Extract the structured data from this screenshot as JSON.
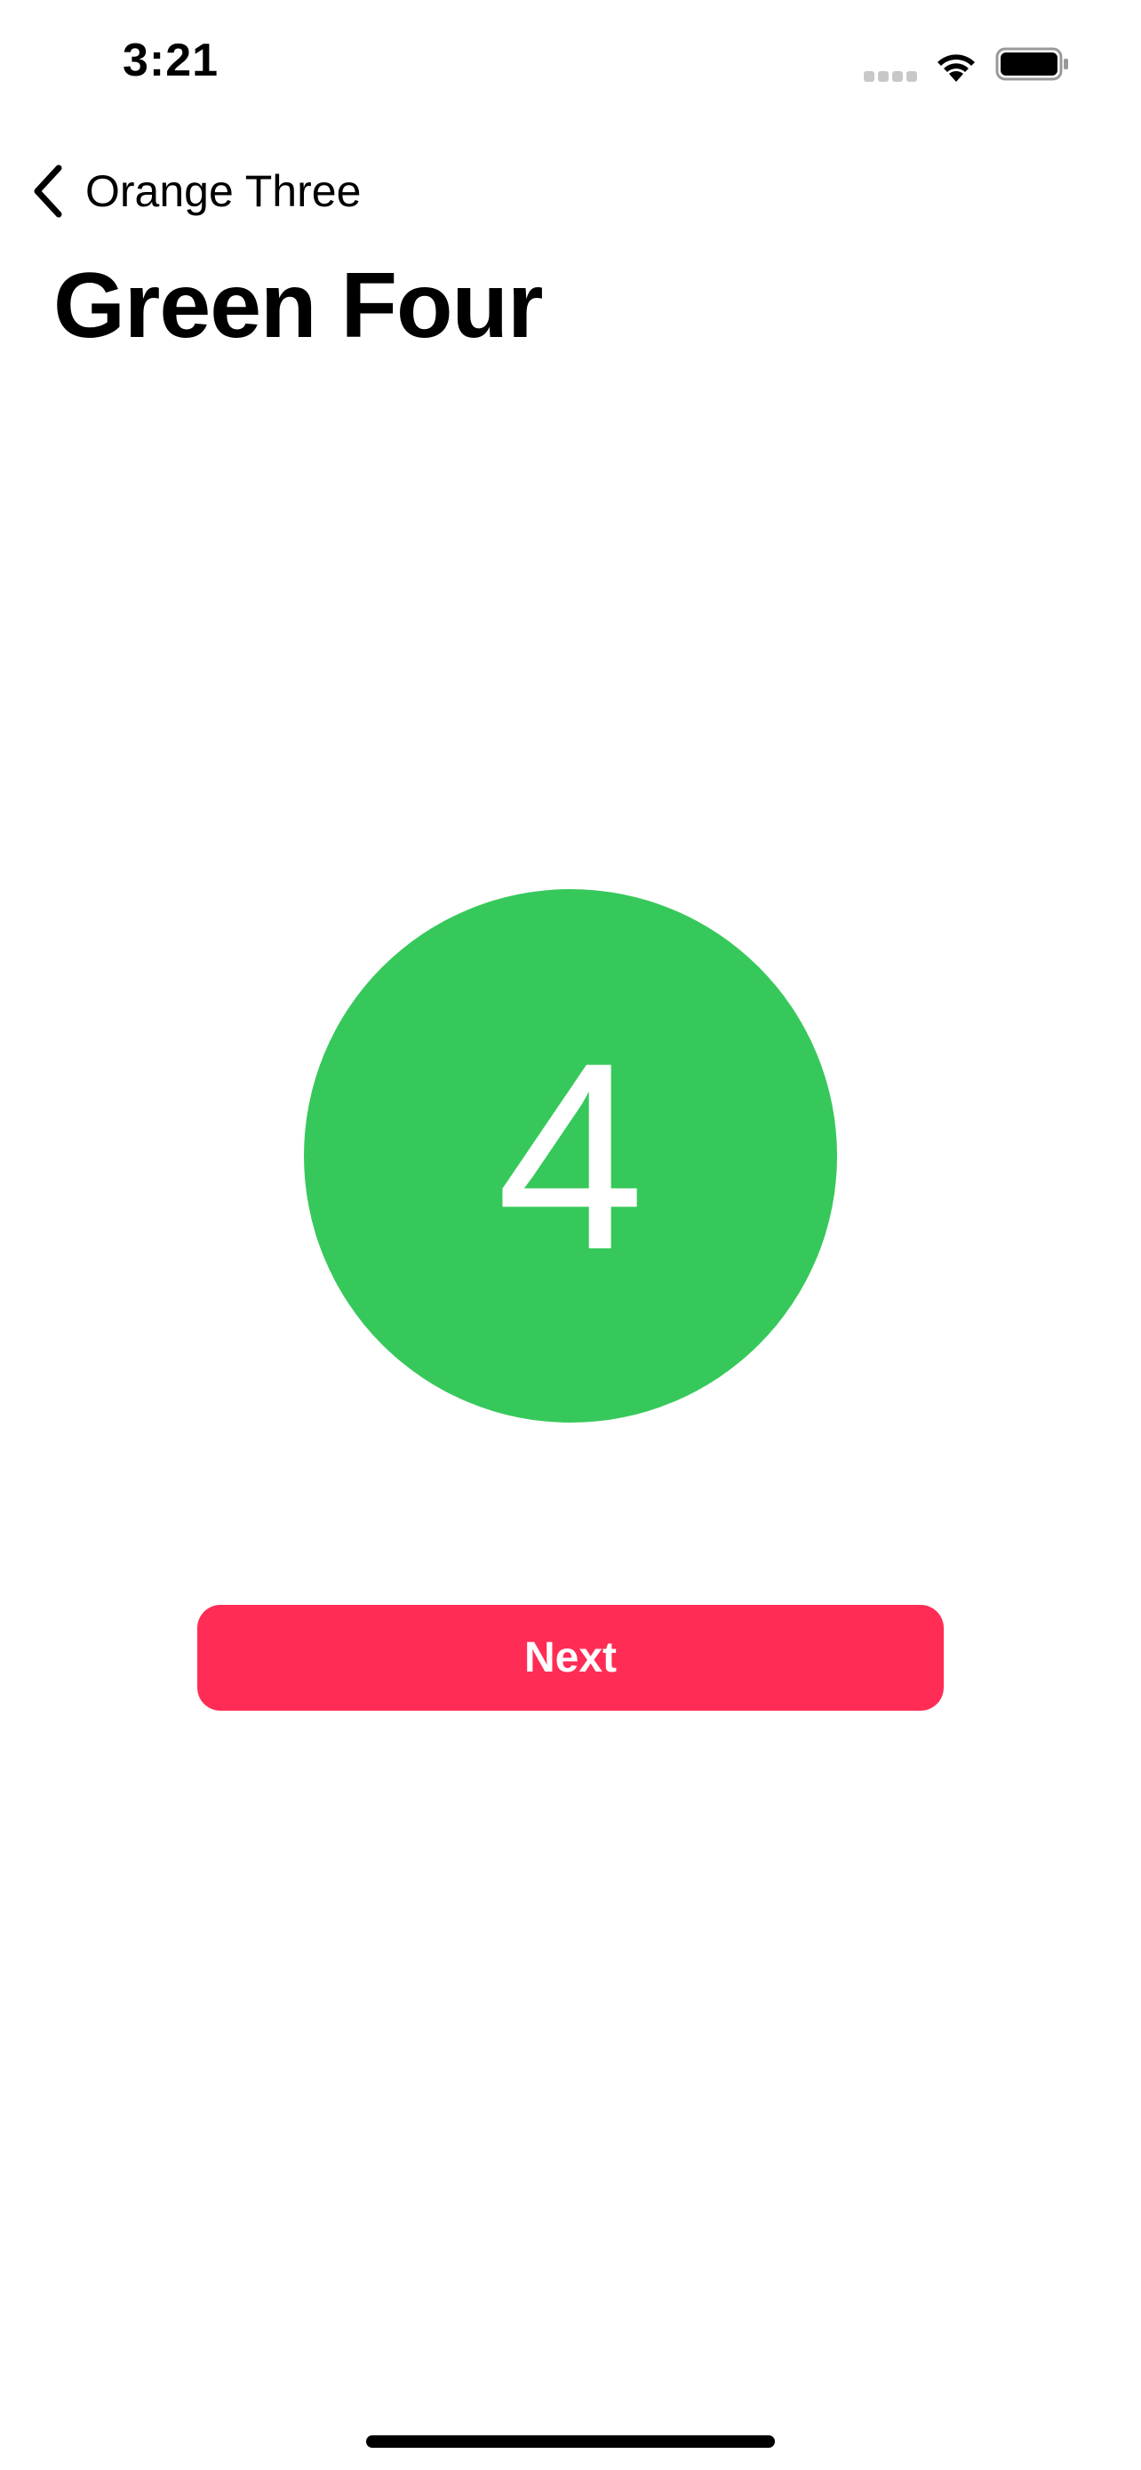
{
  "status_bar": {
    "time": "3:21",
    "icons": [
      "cellular-signal-icon",
      "wifi-icon",
      "battery-icon"
    ]
  },
  "nav": {
    "back_label": "Orange Three",
    "back_icon": "chevron-left-icon"
  },
  "page": {
    "title": "Green Four"
  },
  "badge": {
    "number": "4",
    "color": "#37c85b"
  },
  "next_button": {
    "label": "Next",
    "color": "#ff2d55"
  }
}
